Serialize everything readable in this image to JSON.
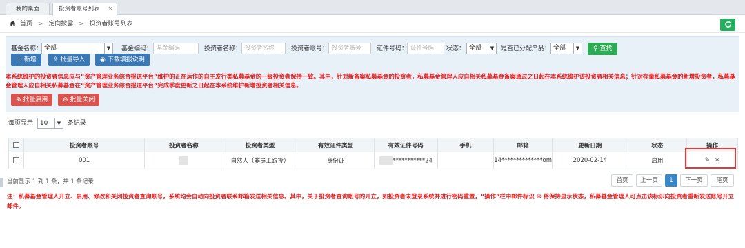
{
  "tabs": [
    {
      "label": "我的桌面"
    },
    {
      "label": "投资者账号列表",
      "close": "×"
    }
  ],
  "breadcrumb": {
    "items": [
      "首页",
      "定向披露",
      "投资者账号列表"
    ],
    "separator": ">"
  },
  "filters": {
    "fund_name_label": "基金名称：",
    "fund_name_value": "全部",
    "fund_code_label": "基金编码：",
    "fund_code_placeholder": "基金编码",
    "investor_name_label": "投资者名称：",
    "investor_name_placeholder": "投资者名称",
    "investor_account_label": "投资者账号：",
    "investor_account_placeholder": "投资者账号",
    "id_no_label": "证件号码：",
    "id_no_placeholder": "证件号码",
    "status_label": "状态：",
    "status_value": "全部",
    "assigned_label": "是否已分配产品：",
    "assigned_value": "全部",
    "search_label": "查找"
  },
  "notice": "本系统维护的投资者信息应与“资产管理业务综合报送平台”维护的正在运作的自主发行类私募基金的一级投资者保持一致。其中，针对新备案私募基金的投资者，私募基金管理人应自相关私募基金备案通过之日起在本系统维护该投资者相关信息；针对存量私募基金的新增投资者，私募基金管理人应自相关私募基金在“资产管理业务综合报送平台”完成季度更新之日起在本系统维护新增投资者相关信息。",
  "toolbar": {
    "add_label": "新增",
    "batch_import_label": "批量导入",
    "download_label": "下载填报说明",
    "batch_enable_label": "批量启用",
    "batch_disable_label": "批量关闭"
  },
  "page_size": {
    "prefix": "每页显示",
    "value": "10",
    "suffix": "条记录"
  },
  "table": {
    "headers": [
      "投资者账号",
      "投资者名称",
      "投资者类型",
      "有效证件类型",
      "有效证件号码",
      "手机",
      "邮箱",
      "更新日期",
      "状态",
      "操作"
    ],
    "rows": [
      {
        "account": "001",
        "name": "",
        "type": "自然人（非员工跟投）",
        "id_type": "身份证",
        "id_no": "***********24",
        "phone": "",
        "email": "14**************om",
        "updated": "2020-02-14",
        "status": "启用"
      }
    ]
  },
  "summary": "当前显示 1 到 1 条，共 1 条记录",
  "pager": {
    "first": "首页",
    "prev": "上一页",
    "current": "1",
    "next": "下一页",
    "last": "尾页"
  },
  "footnote": "注：私募基金管理人开立、启用、修改和关闭投资者查询账号，系统均会自动向投资者联系邮箱发送相关信息。其中，关于投资者查询账号的开立，如投资者未登录系统并进行密码重置，“操作”栏中邮件标识 ✉ 将保持显示状态，私募基金管理人可点击该标识向投资者重新发送账号开立邮件。",
  "colors": {
    "notice_red": "#e02020",
    "primary_blue": "#3a78b6",
    "danger_red": "#d9534f",
    "success_green": "#2eaa54",
    "highlight_frame": "#e53a3a"
  }
}
